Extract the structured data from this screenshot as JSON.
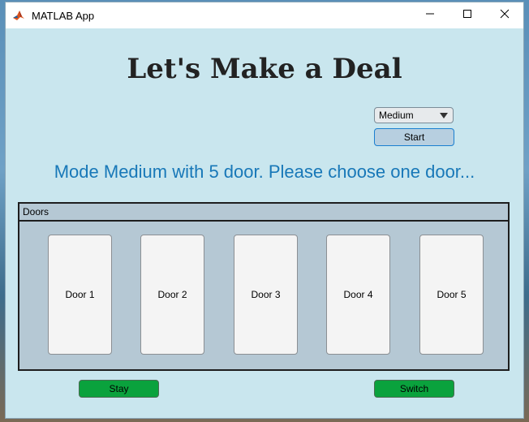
{
  "window": {
    "title": "MATLAB App",
    "controls": {
      "minimize": "minimize-icon",
      "maximize": "maximize-icon",
      "close": "close-icon"
    }
  },
  "page_title": "Let's Make a Deal",
  "mode_select": {
    "selected": "Medium"
  },
  "start_label": "Start",
  "status_text": "Mode Medium with 5 door. Please choose one door...",
  "doors_panel": {
    "title": "Doors",
    "doors": [
      "Door 1",
      "Door 2",
      "Door 3",
      "Door 4",
      "Door 5"
    ]
  },
  "actions": {
    "stay_label": "Stay",
    "switch_label": "Switch"
  },
  "colors": {
    "app_background": "#c9e6ee",
    "status_text": "#1878b8",
    "action_green": "#0aa23d",
    "start_button": "#b7cfe0"
  }
}
